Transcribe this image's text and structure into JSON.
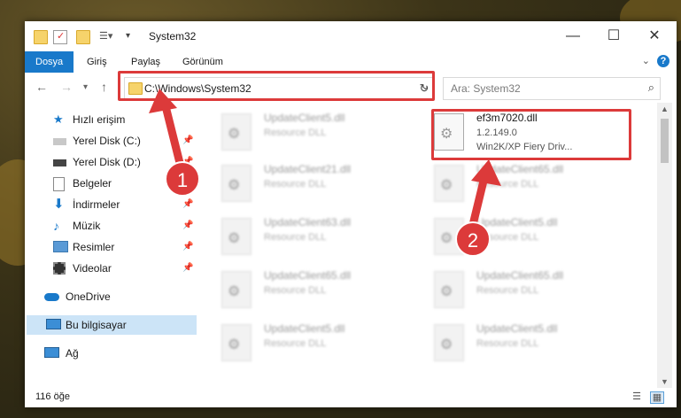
{
  "window": {
    "title": "System32",
    "controls": {
      "minimize": "—",
      "maximize": "☐",
      "close": "✕"
    }
  },
  "ribbon": {
    "tabs": [
      {
        "label": "Dosya",
        "active": true
      },
      {
        "label": "Giriş",
        "active": false
      },
      {
        "label": "Paylaş",
        "active": false
      },
      {
        "label": "Görünüm",
        "active": false
      }
    ],
    "help": "?"
  },
  "address": {
    "path": "C:\\Windows\\System32",
    "search_placeholder": "Ara: System32"
  },
  "sidebar": {
    "items": [
      {
        "label": "Hızlı erişim",
        "icon": "star-icon",
        "pinned": false
      },
      {
        "label": "Yerel Disk (C:)",
        "icon": "drive-icon",
        "pinned": true
      },
      {
        "label": "Yerel Disk (D:)",
        "icon": "drive-icon",
        "pinned": true
      },
      {
        "label": "Belgeler",
        "icon": "document-icon",
        "pinned": true
      },
      {
        "label": "İndirmeler",
        "icon": "download-icon",
        "pinned": true
      },
      {
        "label": "Müzik",
        "icon": "music-icon",
        "pinned": true
      },
      {
        "label": "Resimler",
        "icon": "pictures-icon",
        "pinned": true
      },
      {
        "label": "Videolar",
        "icon": "video-icon",
        "pinned": true
      },
      {
        "label": "OneDrive",
        "icon": "cloud-icon",
        "pinned": false
      },
      {
        "label": "Bu bilgisayar",
        "icon": "computer-icon",
        "pinned": false,
        "selected": true
      },
      {
        "label": "Ağ",
        "icon": "network-icon",
        "pinned": false
      }
    ]
  },
  "files": [
    {
      "name": "UpdateClient5.dll",
      "desc": "Resource DLL"
    },
    {
      "name": "ef3m7020.dll",
      "desc": "1.2.149.0",
      "desc2": "Win2K/XP Fiery Driv...",
      "highlighted": true
    },
    {
      "name": "UpdateClient21.dll",
      "desc": "Resource DLL"
    },
    {
      "name": "UpdateClient65.dll",
      "desc": "Resource DLL"
    },
    {
      "name": "UpdateClient63.dll",
      "desc": "Resource DLL"
    },
    {
      "name": "UpdateClient5.dll",
      "desc": "Resource DLL"
    },
    {
      "name": "UpdateClient65.dll",
      "desc": "Resource DLL"
    },
    {
      "name": "UpdateClient65.dll",
      "desc": "Resource DLL"
    },
    {
      "name": "UpdateClient5.dll",
      "desc": "Resource DLL"
    },
    {
      "name": "UpdateClient5.dll",
      "desc": "Resource DLL"
    }
  ],
  "status": {
    "count": "116 öğe"
  },
  "annotations": {
    "step1": "1",
    "step2": "2"
  },
  "colors": {
    "accent": "#1979ca",
    "highlight": "#dc3a3a",
    "selected": "#cce4f7"
  }
}
